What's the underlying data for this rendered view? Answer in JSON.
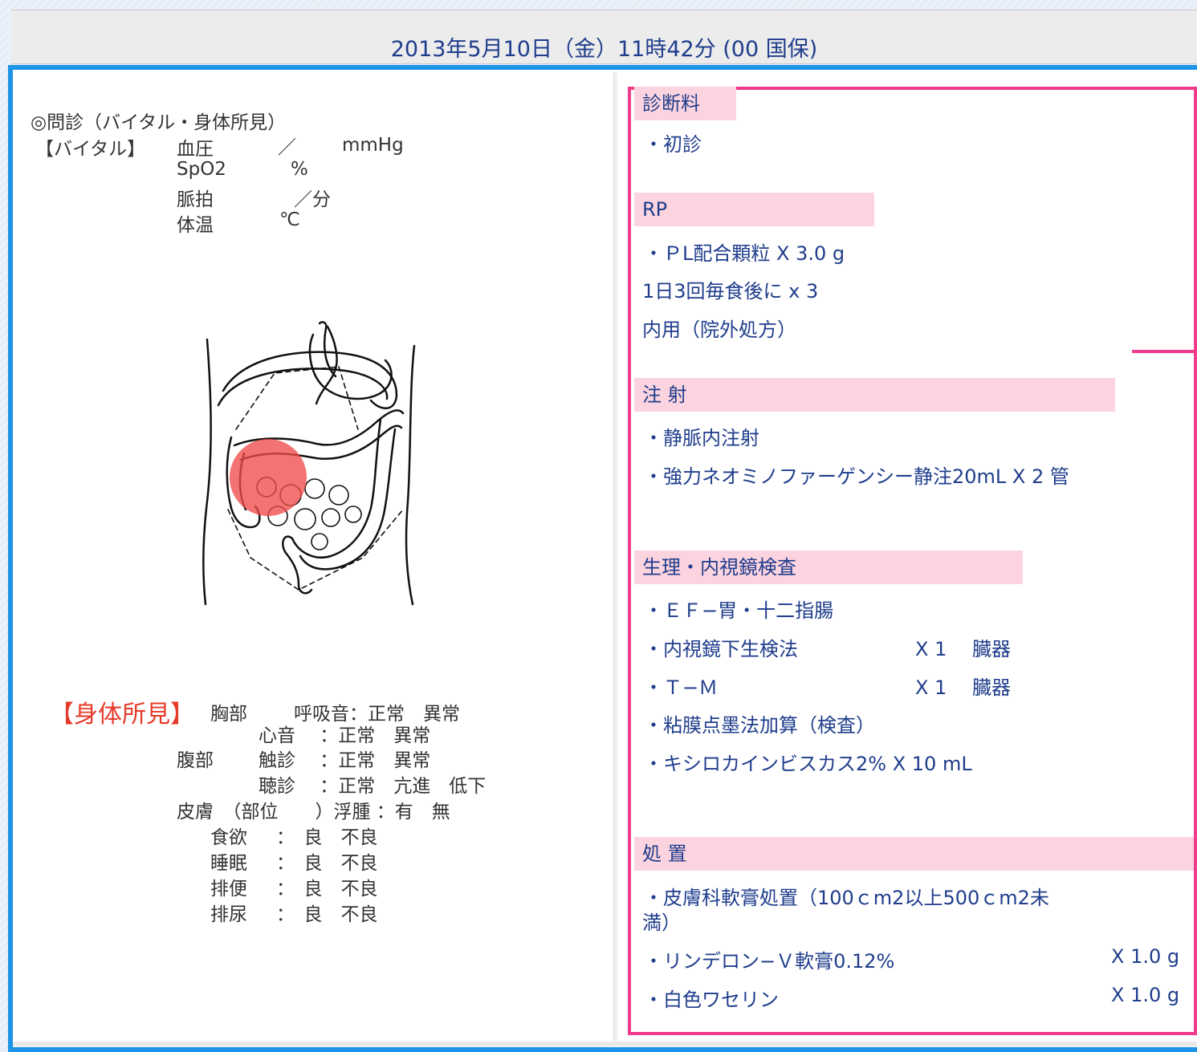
{
  "header": {
    "title": "2013年5月10日（金）11時42分 (00 国保)"
  },
  "inquiry": {
    "title": "◎問診（バイタル・身体所見）",
    "vital_label": "【バイタル】",
    "vitals": [
      {
        "name": "血圧",
        "sep": "／",
        "unit": "mmHg"
      },
      {
        "name": "SpO2",
        "sep": "",
        "unit": "%"
      },
      {
        "name": "脈拍",
        "sep": "",
        "unit": "／分"
      },
      {
        "name": "体温",
        "sep": "",
        "unit": "℃"
      }
    ]
  },
  "illustration": {
    "icon": "abdomen-organs-diagram",
    "marker_color": "#ef4a4a"
  },
  "physical": {
    "title": "【身体所見】",
    "chest": "胸部",
    "breath": "呼吸音：正常　異常",
    "heart": "心音　 ：正常　異常",
    "abdomen": "腹部",
    "palpation": "触診　 ：正常　異常",
    "auscultation": "聴診　 ：正常　亢進　低下",
    "skin": "皮膚　（部位　　）浮腫 ：有　無",
    "items": [
      {
        "label": "食欲",
        "value": "：　良　不良"
      },
      {
        "label": "睡眠",
        "value": "：　良　不良"
      },
      {
        "label": "排便",
        "value": "：　良　不良"
      },
      {
        "label": "排尿",
        "value": "：　良　不良"
      }
    ]
  },
  "orders": {
    "colors": {
      "border": "#ef3b8b",
      "header_bg": "#fcd4df",
      "text": "#1f3d8c",
      "frame": "#1d94e8"
    },
    "sections": [
      {
        "title": "診断料",
        "rows": [
          {
            "text": "・初診"
          }
        ]
      },
      {
        "title": "RP",
        "rows": [
          {
            "text": "・ＰL配合顆粒  X 3.0  g"
          },
          {
            "text": "1日3回毎食後に x 3"
          },
          {
            "text": "内用（院外処方）"
          }
        ]
      },
      {
        "title": "注 射",
        "rows": [
          {
            "text": "・静脈内注射"
          },
          {
            "text": "・強力ネオミノファーゲンシー静注20mL  X 2  管"
          }
        ]
      },
      {
        "title": "生理・内視鏡検査",
        "rows": [
          {
            "text": "・ＥＦ−胃・十二指腸"
          },
          {
            "text": "・内視鏡下生検法",
            "qty": "X 1　 臓器"
          },
          {
            "text": "・Ｔ−Ｍ",
            "qty": "X 1　 臓器"
          },
          {
            "text": "・粘膜点墨法加算（検査）"
          },
          {
            "text": "・キシロカインビスカス2%  X 10  mL"
          }
        ]
      },
      {
        "title": "処 置",
        "rows": [
          {
            "text": "・皮膚科軟膏処置（100ｃm2以上500ｃm2未"
          },
          {
            "text": "満）"
          },
          {
            "text": "・リンデロン−Ｖ軟膏0.12%",
            "qty": "X 1.0  g"
          },
          {
            "text": "・白色ワセリン",
            "qty": "X 1.0  g"
          }
        ]
      }
    ]
  }
}
